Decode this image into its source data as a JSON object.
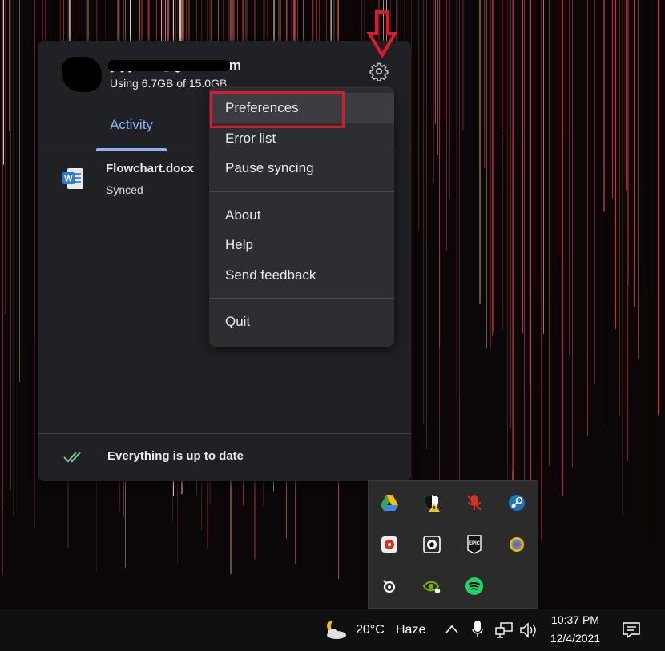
{
  "drive": {
    "account": {
      "email": "y  j   j   r   ll2@gmail.com",
      "usage": "Using 6.7GB of 15.0GB"
    },
    "icons": {
      "gear": "gear-icon",
      "avatar": "avatar"
    },
    "tabs": [
      {
        "label": "Activity",
        "active": true
      }
    ],
    "files": [
      {
        "name": "Flowchart.docx",
        "status": "Synced",
        "icon": "word-doc-icon"
      }
    ],
    "footer": {
      "status": "Everything is up to date",
      "icon": "double-check-icon"
    }
  },
  "menu": {
    "groups": [
      [
        "Preferences",
        "Error list",
        "Pause syncing"
      ],
      [
        "About",
        "Help",
        "Send feedback"
      ],
      [
        "Quit"
      ]
    ],
    "highlighted": "Preferences"
  },
  "tray_overflow": {
    "icons": [
      "google-drive-icon",
      "windows-security-warning-icon",
      "microphone-muted-icon",
      "steam-icon",
      "bandicam-icon",
      "soccer-ball-icon",
      "epic-games-icon",
      "language-bar-icon",
      "steelseries-icon",
      "nvidia-icon",
      "spotify-icon"
    ]
  },
  "taskbar": {
    "weather": {
      "temperature": "20°C",
      "condition": "Haze",
      "icon": "moon-cloud-icon"
    },
    "clock": {
      "time": "10:37 PM",
      "date": "12/4/2021"
    },
    "icons": [
      "chevron-up-icon",
      "microphone-icon",
      "network-icon",
      "volume-icon",
      "notification-icon"
    ]
  },
  "colors": {
    "accent": "#8ab4f8",
    "panel": "#202124",
    "menu": "#2d2e31",
    "annotation": "#e0192a"
  }
}
